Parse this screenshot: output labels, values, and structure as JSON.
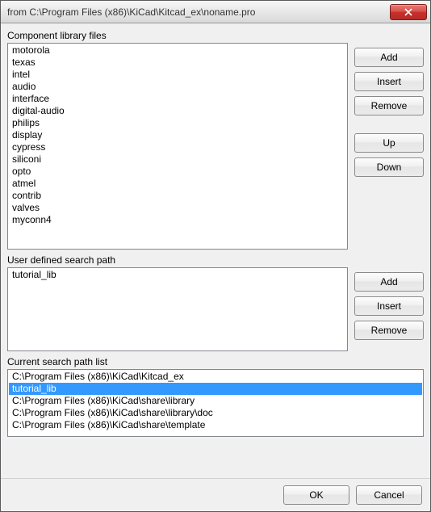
{
  "window": {
    "title": "from C:\\Program Files (x86)\\KiCad\\Kitcad_ex\\noname.pro"
  },
  "sections": {
    "component_libs": {
      "label": "Component library files",
      "items": [
        "motorola",
        "texas",
        "intel",
        "audio",
        "interface",
        "digital-audio",
        "philips",
        "display",
        "cypress",
        "siliconi",
        "opto",
        "atmel",
        "contrib",
        "valves",
        "myconn4"
      ],
      "buttons": {
        "add": "Add",
        "insert": "Insert",
        "remove": "Remove",
        "up": "Up",
        "down": "Down"
      }
    },
    "user_paths": {
      "label": "User defined search path",
      "items": [
        "tutorial_lib"
      ],
      "buttons": {
        "add": "Add",
        "insert": "Insert",
        "remove": "Remove"
      }
    },
    "current_paths": {
      "label": "Current search path list",
      "items": [
        "C:\\Program Files (x86)\\KiCad\\Kitcad_ex",
        "tutorial_lib",
        "C:\\Program Files (x86)\\KiCad\\share\\library",
        "C:\\Program Files (x86)\\KiCad\\share\\library\\doc",
        "C:\\Program Files (x86)\\KiCad\\share\\template"
      ],
      "selected_index": 1
    }
  },
  "footer": {
    "ok": "OK",
    "cancel": "Cancel"
  }
}
